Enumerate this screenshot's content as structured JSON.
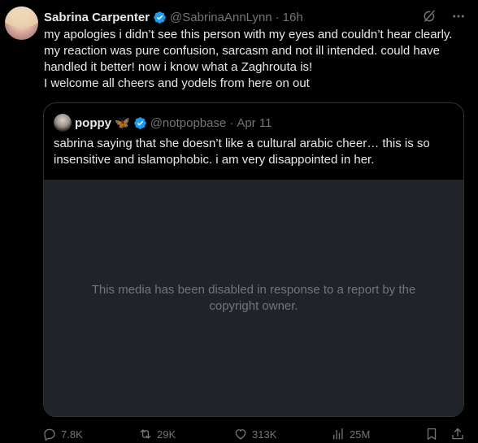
{
  "tweet": {
    "author": {
      "display_name": "Sabrina Carpenter",
      "handle": "@SabrinaAnnLynn",
      "separator": "·",
      "time": "16h"
    },
    "text_lines": [
      "my apologies i didn’t see this person with my eyes and couldn’t hear clearly. my reaction was pure confusion, sarcasm and not ill intended. could have handled it better! now i know what a Zaghrouta is!",
      "I welcome all cheers and yodels from here on out"
    ],
    "quoted": {
      "display_name": "poppy",
      "emoji": "🦋",
      "handle": "@notpopbase",
      "separator": "·",
      "time": "Apr 11",
      "text": "sabrina saying that she doesn’t like a cultural arabic cheer… this is so insensitive and islamophobic. i am very disappointed in her.",
      "media_notice": "This media has been disabled in response to a report by the copyright owner."
    },
    "stats": {
      "replies": "7.8K",
      "reposts": "29K",
      "likes": "313K",
      "views": "25M"
    }
  },
  "icons": {
    "verified": "verified-badge-icon",
    "grok": "grok-icon",
    "more": "more-icon",
    "reply": "reply-icon",
    "repost": "repost-icon",
    "like": "like-icon",
    "views": "views-icon",
    "bookmark": "bookmark-icon",
    "share": "share-icon"
  },
  "colors": {
    "background": "#000000",
    "text": "#e7e9ea",
    "muted": "#71767b",
    "verified": "#1d9bf0",
    "border": "#2f3336",
    "media_bg": "#202327"
  }
}
